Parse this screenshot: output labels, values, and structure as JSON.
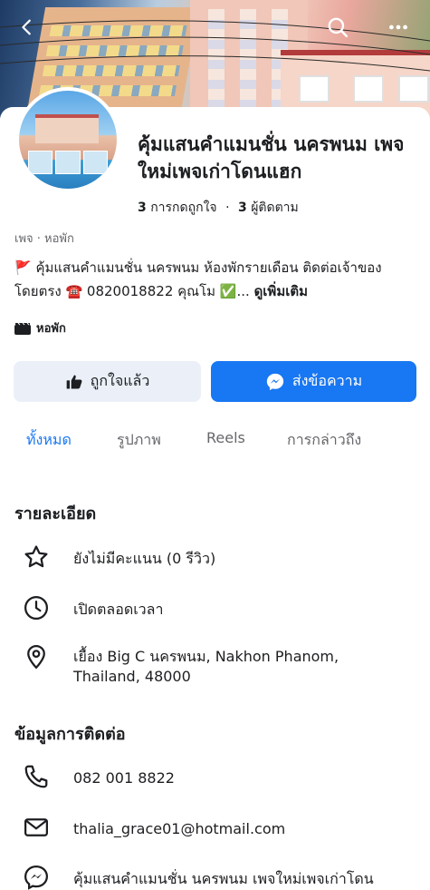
{
  "header": {
    "back_icon": "chevron-left-icon",
    "search_icon": "search-icon",
    "more_icon": "more-horizontal-icon"
  },
  "page": {
    "title": "คุ้มแสนคำแมนชั่น นครพนม เพจใหม่เพจเก่าโดนแฮก",
    "likes_count": "3",
    "likes_label": "การกดถูกใจ",
    "followers_count": "3",
    "followers_label": "ผู้ติดตาม",
    "category": "เพจ · หอพัก",
    "description": "🚩 คุ้มแสนคำแมนชั่น นครพนม ห้องพักรายเดือน ติดต่อเจ้าของโดยตรง ☎️ 0820018822 คุณโม ✅...",
    "see_more": "ดูเพิ่มเติม",
    "tag": "หอพัก"
  },
  "actions": {
    "liked_label": "ถูกใจแล้ว",
    "message_label": "ส่งข้อความ"
  },
  "tabs": [
    {
      "label": "ทั้งหมด",
      "active": true
    },
    {
      "label": "รูปภาพ",
      "active": false
    },
    {
      "label": "Reels",
      "active": false
    },
    {
      "label": "การกล่าวถึง",
      "active": false
    }
  ],
  "details": {
    "title": "รายละเอียด",
    "rating": "ยังไม่มีคะแนน (0 รีวิว)",
    "hours": "เปิดตลอดเวลา",
    "address": "เยื้อง Big C นครพนม, Nakhon Phanom, Thailand, 48000"
  },
  "contact": {
    "title": "ข้อมูลการติดต่อ",
    "phone": "082 001 8822",
    "email": "thalia_grace01@hotmail.com",
    "messenger": "คุ้มแสนคำแมนชั่น นครพนม เพจใหม่เพจเก่าโดน"
  },
  "colors": {
    "accent": "#1877f2",
    "like_button_bg": "#ebf0f8"
  }
}
